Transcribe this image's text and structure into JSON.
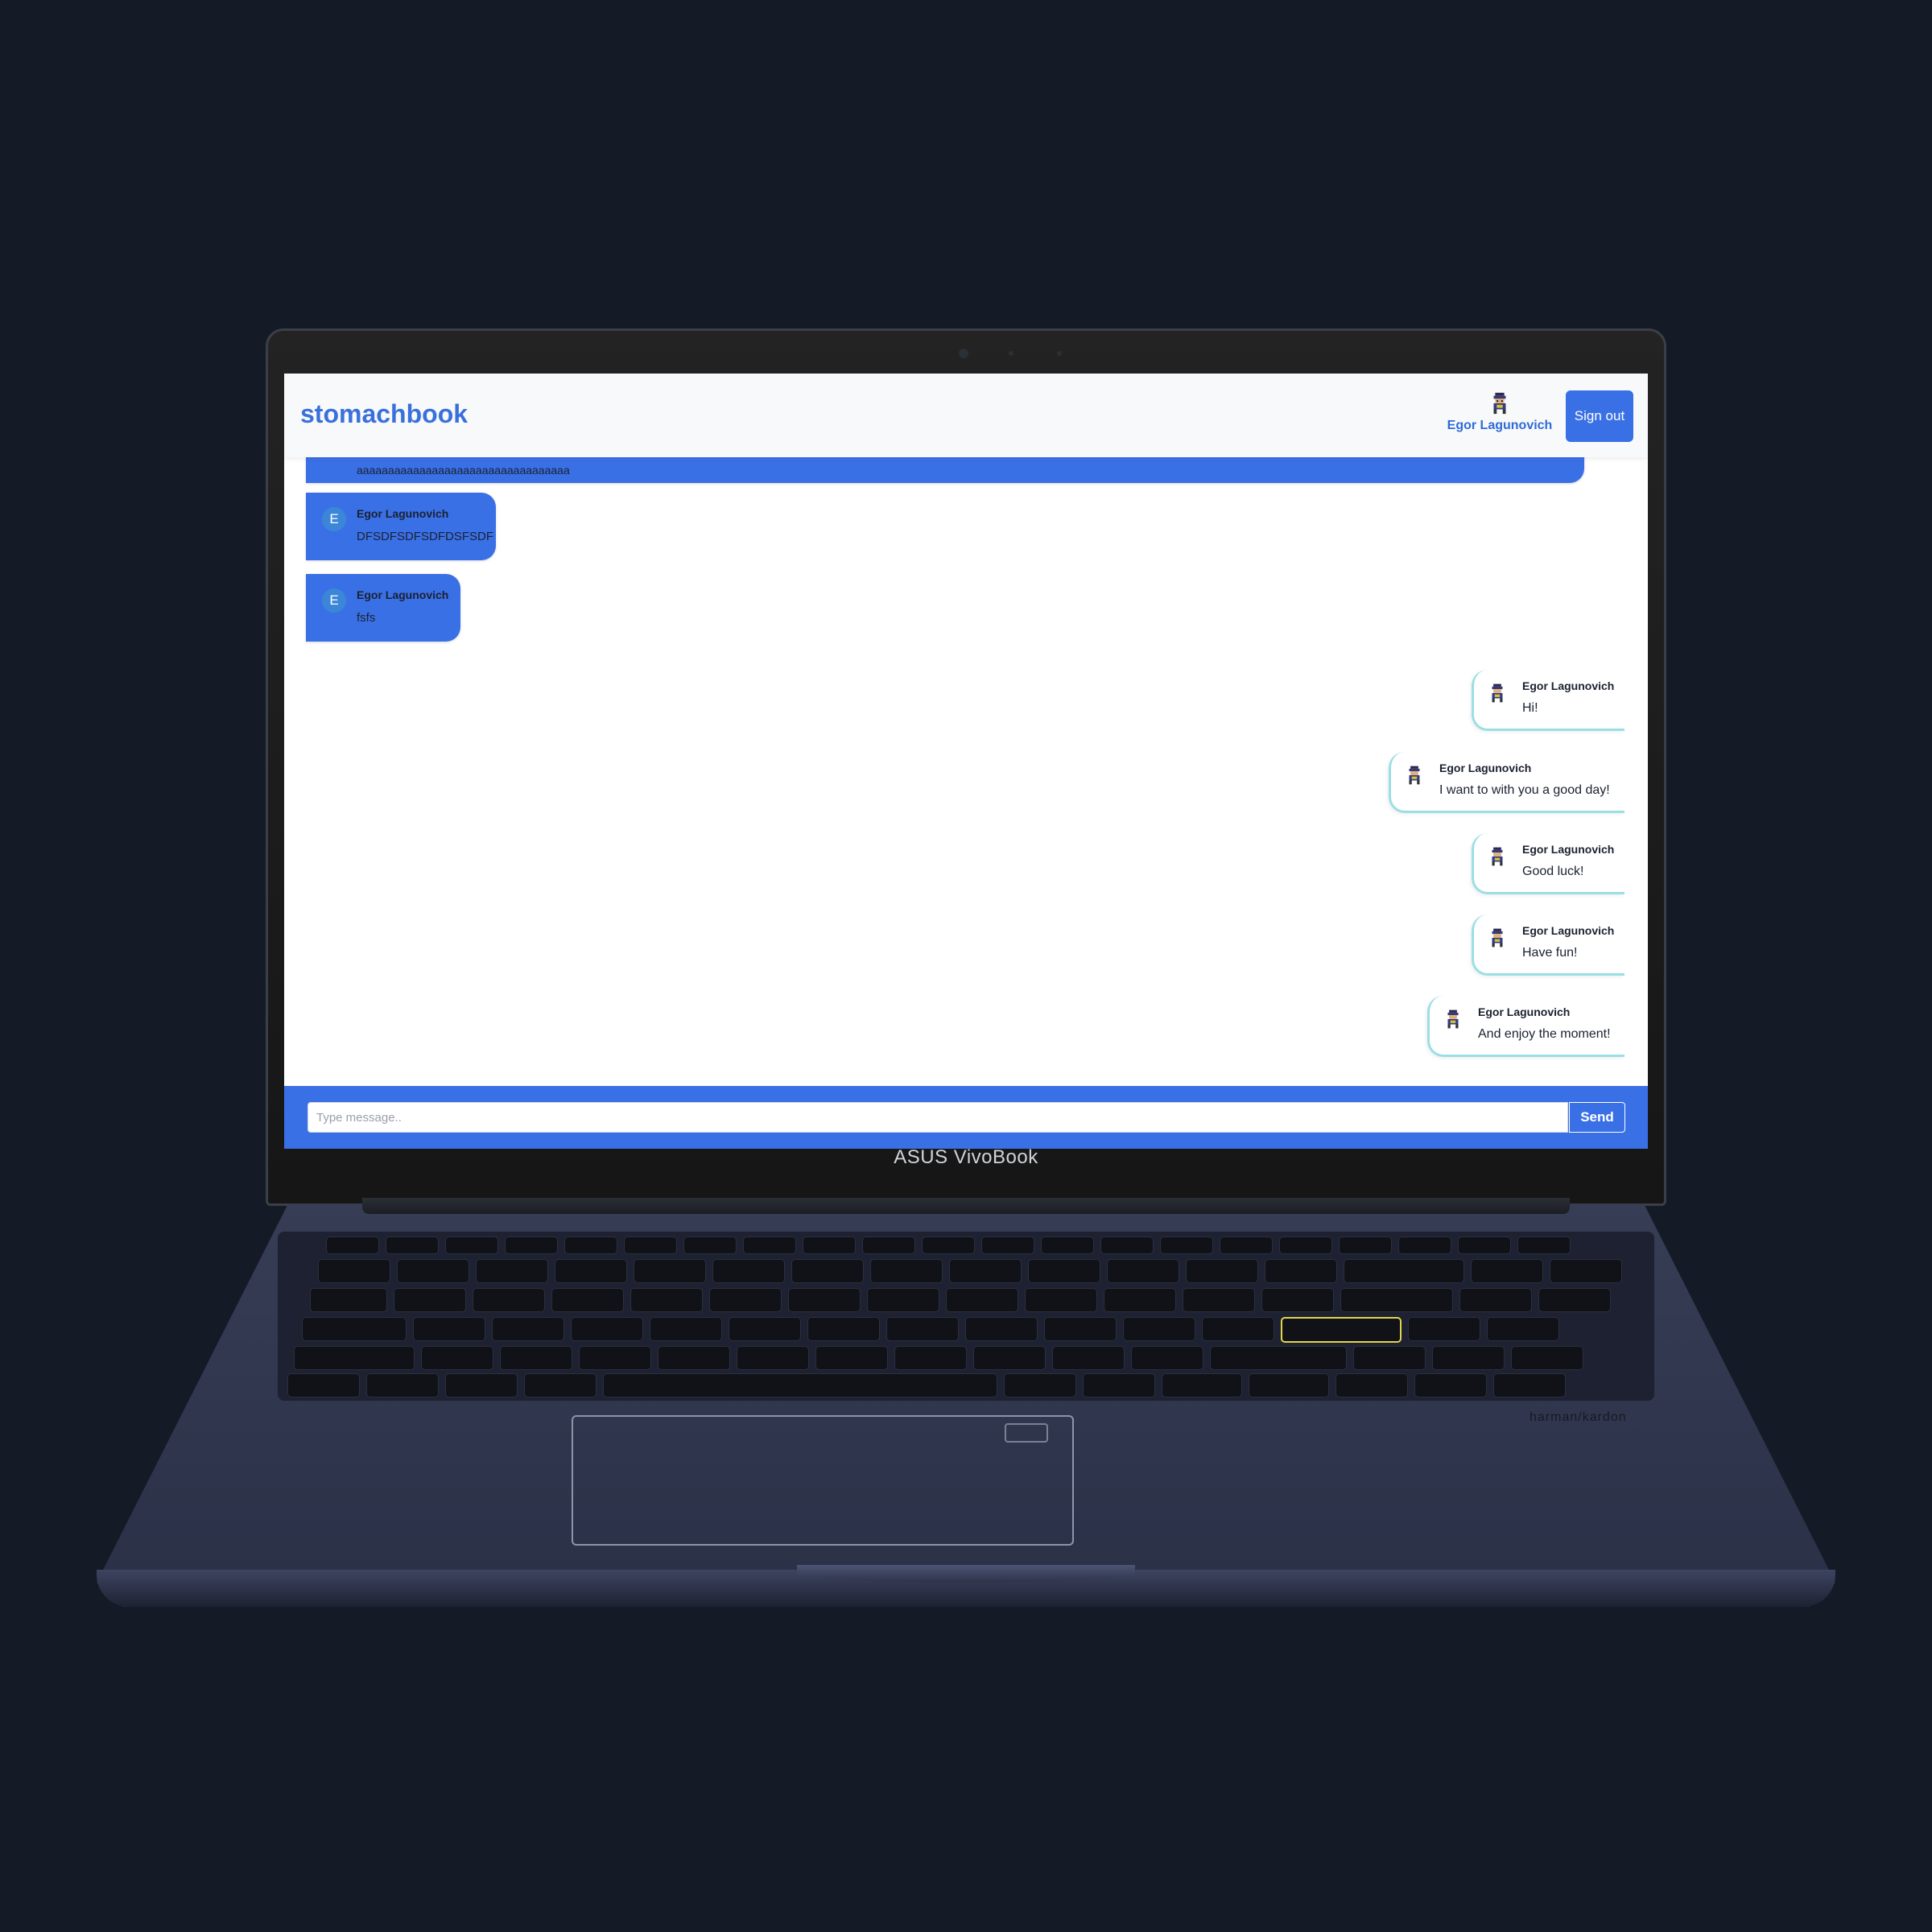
{
  "app": {
    "logo": "stomachbook",
    "user": {
      "name": "Egor Lagunovich"
    },
    "sign_out_label": "Sign out"
  },
  "messages": [
    {
      "side": "left",
      "avatar_letter": "",
      "name": "",
      "text": "aaaaaaaaaaaaaaaaaaaaaaaaaaaaaaaaaa"
    },
    {
      "side": "left",
      "avatar_letter": "E",
      "name": "Egor Lagunovich",
      "text": "DFSDFSDFSDFDSFSDF"
    },
    {
      "side": "left",
      "avatar_letter": "E",
      "name": "Egor Lagunovich",
      "text": "fsfs"
    },
    {
      "side": "right",
      "name": "Egor Lagunovich",
      "text": "Hi!"
    },
    {
      "side": "right",
      "name": "Egor Lagunovich",
      "text": "I want to with you a good day!"
    },
    {
      "side": "right",
      "name": "Egor Lagunovich",
      "text": "Good luck!"
    },
    {
      "side": "right",
      "name": "Egor Lagunovich",
      "text": "Have fun!"
    },
    {
      "side": "right",
      "name": "Egor Lagunovich",
      "text": "And enjoy the moment!"
    }
  ],
  "composer": {
    "placeholder": "Type message..",
    "send_label": "Send"
  },
  "device": {
    "brand": "ASUS VivoBook",
    "speaker_brand": "harman/kardon"
  },
  "colors": {
    "accent": "#3a70e6",
    "right_bubble_border": "#9adfe4",
    "background": "#151a27"
  },
  "icons": {
    "user_avatar": "pixel-character-icon"
  }
}
